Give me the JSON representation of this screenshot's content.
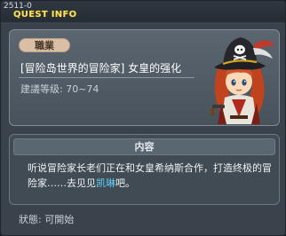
{
  "window": {
    "quest_id": "2511-0",
    "title": "QUEST INFO"
  },
  "quest": {
    "job_badge": "職業",
    "name": "[冒险岛世界的冒险家] 女皇的强化",
    "level_label": "建議等级: 70~74",
    "npc_icon": "pirate-girl-portrait"
  },
  "content": {
    "header": "内容",
    "text_before": "听说冒险家长老们正在和女皇希纳斯合作，打造终极的冒险家……去见见",
    "npc_name": "凯琳",
    "text_after": "吧。"
  },
  "status": {
    "label": "狀態: 可開始"
  },
  "colors": {
    "title_yellow": "#ffe15a",
    "npc_link_blue": "#5fd3ff",
    "badge_tan": "#d8bfa6"
  }
}
